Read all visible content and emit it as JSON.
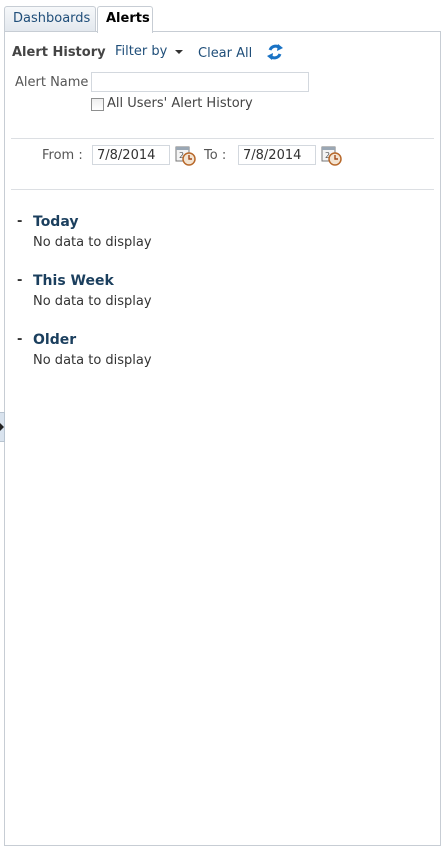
{
  "tabs": [
    {
      "label": "Dashboards",
      "selected": false
    },
    {
      "label": "Alerts",
      "selected": true
    }
  ],
  "header": {
    "title": "Alert History",
    "filter_label": "Filter by",
    "clear_label": "Clear All",
    "refresh_icon": "refresh-icon"
  },
  "filters": {
    "alert_name_label": "Alert Name",
    "alert_name_value": "",
    "all_users_label": "All Users' Alert History",
    "all_users_checked": false,
    "from_label": "From :",
    "from_value": "7/8/2014",
    "to_label": "To :",
    "to_value": "7/8/2014",
    "calendar_icon": "calendar-icon"
  },
  "groups": [
    {
      "toggle": "-",
      "title": "Today",
      "empty_text": "No data to display"
    },
    {
      "toggle": "-",
      "title": "This Week",
      "empty_text": "No data to display"
    },
    {
      "toggle": "-",
      "title": "Older",
      "empty_text": "No data to display"
    }
  ],
  "colors": {
    "link": "#1f4e79",
    "group_title": "#1b3f5e",
    "border": "#c7cdd4"
  }
}
